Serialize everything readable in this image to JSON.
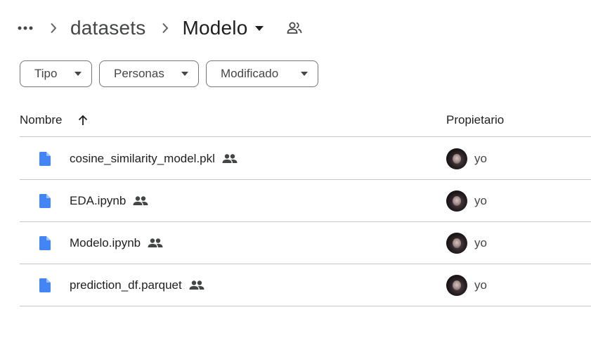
{
  "breadcrumb": {
    "parent_label": "datasets",
    "current_label": "Modelo"
  },
  "filters": [
    {
      "label": "Tipo"
    },
    {
      "label": "Personas"
    },
    {
      "label": "Modificado"
    }
  ],
  "table": {
    "columns": {
      "name": "Nombre",
      "owner": "Propietario"
    },
    "rows": [
      {
        "name": "cosine_similarity_model.pkl",
        "owner": "yo"
      },
      {
        "name": "EDA.ipynb",
        "owner": "yo"
      },
      {
        "name": "Modelo.ipynb",
        "owner": "yo"
      },
      {
        "name": "prediction_df.parquet",
        "owner": "yo"
      }
    ]
  },
  "icons": {
    "more": "more-horiz-icon",
    "chevron": "chevron-right-icon",
    "caret": "caret-down-icon",
    "shared": "people-icon",
    "file": "file-icon",
    "sort": "arrow-up-icon"
  },
  "colors": {
    "file_icon": "#4285f4",
    "text_primary": "#1f1f1f",
    "text_secondary": "#444746",
    "divider": "#c4c7c5"
  }
}
